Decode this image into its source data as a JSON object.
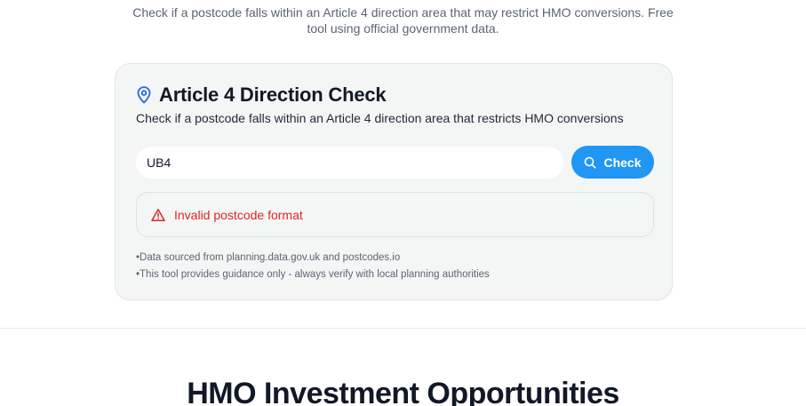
{
  "intro": {
    "line1": "Check if a postcode falls within an Article 4 direction area that may restrict HMO conversions. Free",
    "line2": "tool using official government data."
  },
  "card": {
    "icon": "map-pin-icon",
    "title": "Article 4 Direction Check",
    "subtitle": "Check if a postcode falls within an Article 4 direction area that restricts HMO conversions",
    "postcode_value": "UB4",
    "check_label": "Check",
    "check_icon": "search-icon",
    "error_icon": "warning-icon",
    "error_message": "Invalid postcode format",
    "notes": [
      "Data sourced from planning.data.gov.uk and postcodes.io",
      "This tool provides guidance only - always verify with local planning authorities"
    ]
  },
  "next_section": {
    "heading": "HMO Investment Opportunities"
  },
  "colors": {
    "accent": "#2196f3",
    "error": "#dc2626",
    "card_bg": "#f4f6f5"
  }
}
